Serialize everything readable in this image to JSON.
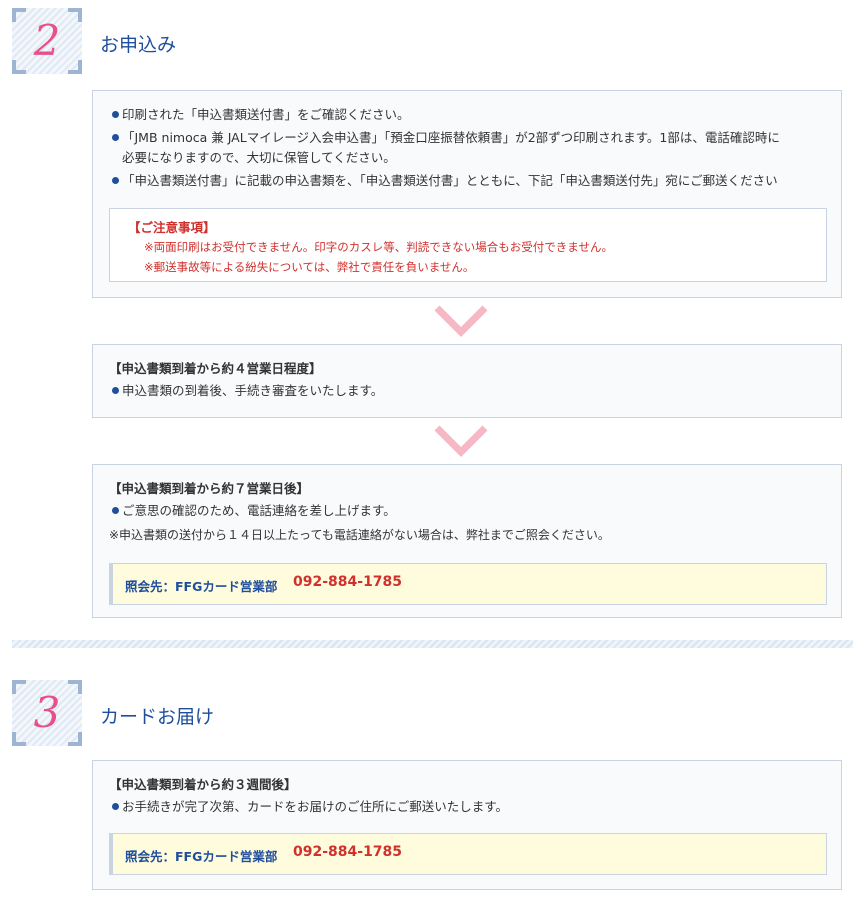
{
  "step2": {
    "number": "2",
    "title": "お申込み",
    "box1": {
      "bullets": [
        "印刷された「申込書類送付書」をご確認ください。",
        "「JMB nimoca 兼 JALマイレージ入会申込書」「預金口座振替依頼書」が2部ずつ印刷されます。1部は、電話確認時に",
        "「申込書類送付書」に記載の申込書類を、「申込書類送付書」とともに、下記「申込書類送付先」宛にご郵送ください"
      ],
      "bullet2_cont": "必要になりますので、大切に保管してください。",
      "caution": {
        "title": "【ご注意事項】",
        "items": [
          "※両面印刷はお受付できません。印字のカスレ等、判読できない場合もお受付できません。",
          "※郵送事故等による紛失については、弊社で責任を負いません。"
        ]
      }
    },
    "box2": {
      "heading": "【申込書類到着から約４営業日程度】",
      "bullet": "申込書類の到着後、手続き審査をいたします。"
    },
    "box3": {
      "heading": "【申込書類到着から約７営業日後】",
      "bullet": "ご意思の確認のため、電話連絡を差し上げます。",
      "note": "※申込書類の送付から１４日以上たっても電話連絡がない場合は、弊社までご照会ください。",
      "contact_label": "照会先：FFGカード営業部",
      "contact_tel": "092-884-1785"
    }
  },
  "step3": {
    "number": "3",
    "title": "カードお届け",
    "box": {
      "heading": "【申込書類到着から約３週間後】",
      "bullet": "お手続きが完了次第、カードをお届けのご住所にご郵送いたします。",
      "contact_label": "照会先：FFGカード営業部",
      "contact_tel": "092-884-1785"
    }
  },
  "colors": {
    "accent": "#1f4e9c",
    "number": "#e8508a",
    "warning": "#d0312d",
    "arrow": "#f5b8c4"
  }
}
